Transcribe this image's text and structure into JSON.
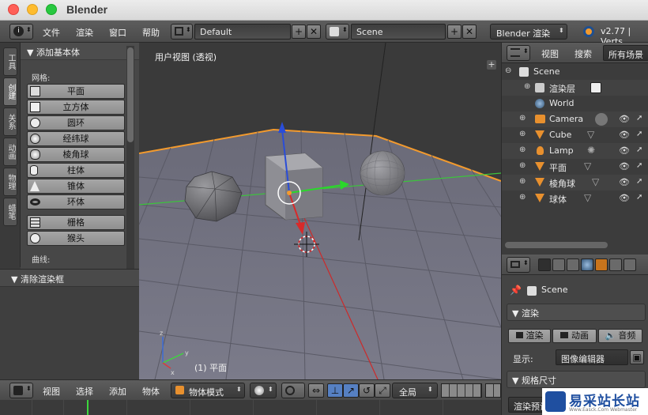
{
  "window": {
    "title": "Blender"
  },
  "topbar": {
    "menus": [
      "文件",
      "渲染",
      "窗口",
      "帮助"
    ],
    "layout_name": "Default",
    "scene_name": "Scene",
    "render_engine": "Blender 渲染",
    "version": "v2.77 | Verts"
  },
  "tabs": [
    "工具",
    "创建",
    "关系",
    "动画",
    "物理",
    "蜡笔"
  ],
  "tool_panel": {
    "header": "▼ 添加基本体",
    "mesh_label": "网格:",
    "mesh_buttons": [
      "平面",
      "立方体",
      "圆环",
      "经纬球",
      "棱角球",
      "柱体",
      "锥体",
      "环体"
    ],
    "extra_buttons": [
      "栅格",
      "猴头"
    ],
    "curve_label": "曲线:"
  },
  "redo_panel": {
    "header": "▼ 清除渲染框"
  },
  "viewport": {
    "label": "用户视图 (透视)",
    "active_object": "(1) 平面"
  },
  "outliner": {
    "menus": [
      "视图",
      "搜索"
    ],
    "scope": "所有场景",
    "rows": [
      "Scene",
      "渲染层",
      "World",
      "Camera",
      "Cube",
      "Lamp",
      "平面",
      "棱角球",
      "球体"
    ]
  },
  "properties": {
    "context": "Scene",
    "render_section": "▼ 渲染",
    "render_btn": "渲染",
    "anim_btn": "动画",
    "audio_btn": "音频",
    "display_label": "显示:",
    "display_value": "图像编辑器",
    "dimensions_section": "▼ 规格尺寸",
    "preset_partial": "渲染预设"
  },
  "bottombar": {
    "menus": [
      "视图",
      "选择",
      "添加",
      "物体"
    ],
    "mode": "物体模式",
    "orientation": "全局"
  },
  "watermark": {
    "text": "易采站长站",
    "sub": "Www.Easck.Com Webmaster"
  },
  "colors": {
    "accent": "#f29a2e",
    "axis_x": "#d73c3c",
    "axis_y": "#3cd73c",
    "axis_z": "#3c6cd7",
    "grid_floor": "#6f6f7c"
  }
}
